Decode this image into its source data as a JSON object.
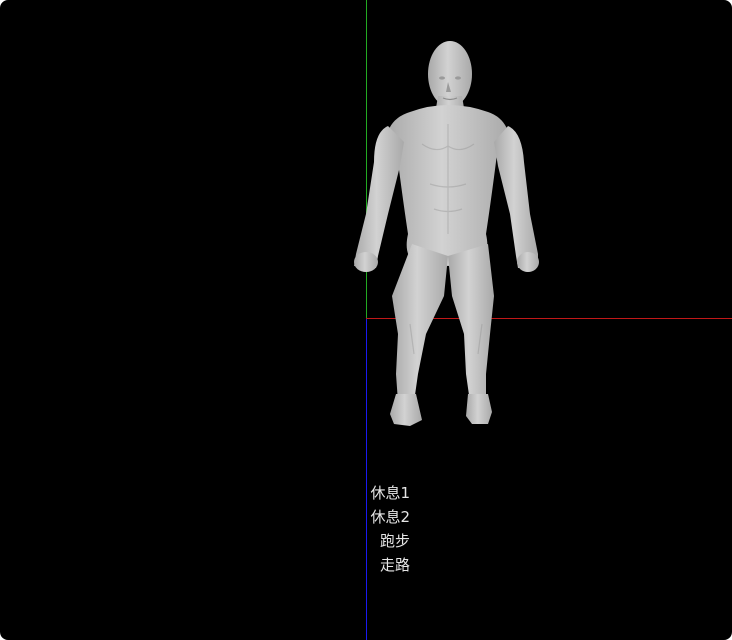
{
  "viewport": {
    "background": "#000000"
  },
  "axes": {
    "x_color": "#c01818",
    "y_color": "#22aa22",
    "z_color": "#1a1aee"
  },
  "model": {
    "skin_color": "#d2d2d2",
    "shadow_color": "#a9a9a9"
  },
  "animation_menu": {
    "items": [
      {
        "label": "休息1"
      },
      {
        "label": "休息2"
      },
      {
        "label": "跑步"
      },
      {
        "label": "走路"
      }
    ]
  }
}
